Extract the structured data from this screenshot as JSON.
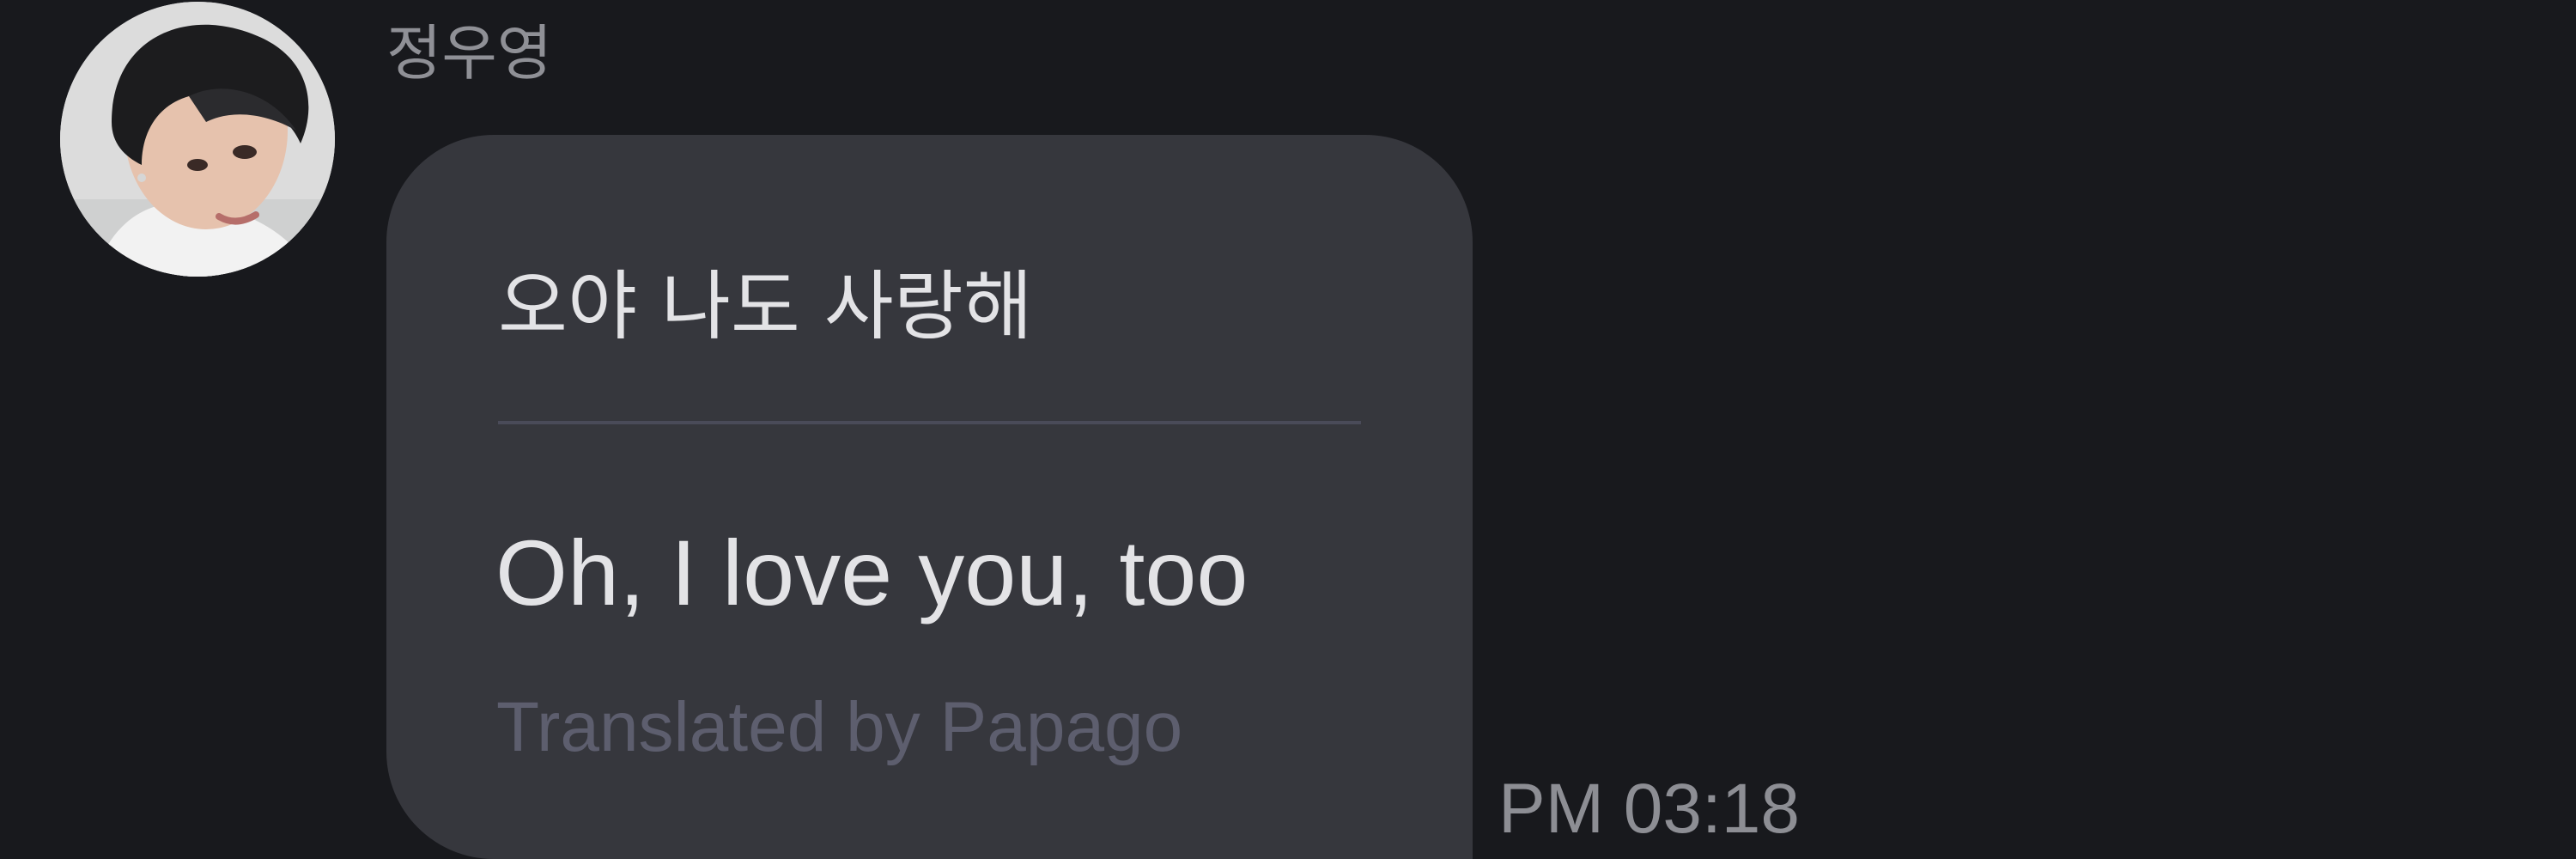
{
  "message": {
    "sender_name": "정우영",
    "avatar_icon": "profile-photo",
    "original_text": "오야 나도 사랑해",
    "translated_text": "Oh, I love you, too",
    "translation_credit": "Translated by Papago",
    "timestamp": "PM 03:18"
  },
  "colors": {
    "background": "#18191d",
    "bubble": "#36373d",
    "text": "#e3e3e6",
    "muted_text": "#8f9096",
    "attribution_text": "#5d5e6e",
    "divider": "#4a4b59"
  }
}
